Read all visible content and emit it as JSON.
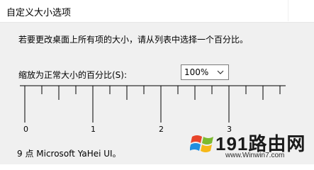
{
  "window": {
    "title": "自定义大小选项"
  },
  "dialog": {
    "instruction": "若要更改桌面上所有项的大小，请从列表中选择一个百分比。",
    "scale_label": "缩放为正常大小的百分比(S):",
    "scale_select": {
      "value": "100%"
    },
    "ruler": {
      "numbers": [
        "0",
        "1",
        "2",
        "3"
      ]
    },
    "font_info": "9 点 Microsoft YaHei UI。"
  },
  "watermark": {
    "logo": "windows-flag-logo",
    "text": "191路由网",
    "url": "www.Winwin7.com"
  }
}
